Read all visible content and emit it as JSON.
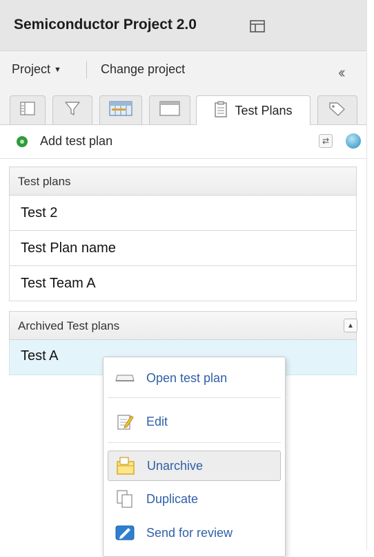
{
  "title": "Semiconductor Project 2.0",
  "menu": {
    "project_label": "Project",
    "change_project_label": "Change project"
  },
  "tabs": [
    {
      "icon": "list-icon"
    },
    {
      "icon": "filter-icon"
    },
    {
      "icon": "timeline-icon"
    },
    {
      "icon": "window-icon"
    },
    {
      "icon": "clipboard-icon",
      "label": "Test Plans",
      "active": true
    },
    {
      "icon": "tag-icon"
    }
  ],
  "actions": {
    "add_label": "Add test plan"
  },
  "test_plans": {
    "header": "Test plans",
    "items": [
      "Test 2",
      "Test Plan name",
      "Test Team A"
    ]
  },
  "archived": {
    "header": "Archived Test plans",
    "items": [
      "Test A"
    ]
  },
  "context_menu": {
    "items": [
      {
        "label": "Open test plan",
        "icon": "open-icon"
      },
      {
        "label": "Edit",
        "icon": "edit-icon"
      },
      {
        "label": "Unarchive",
        "icon": "unarchive-icon",
        "highlighted": true
      },
      {
        "label": "Duplicate",
        "icon": "duplicate-icon"
      },
      {
        "label": "Send for review",
        "icon": "send-review-icon"
      }
    ]
  },
  "colors": {
    "link": "#2f5fa8",
    "accent_green": "#2e9b3a",
    "selected_row": "#e4f4fb"
  }
}
